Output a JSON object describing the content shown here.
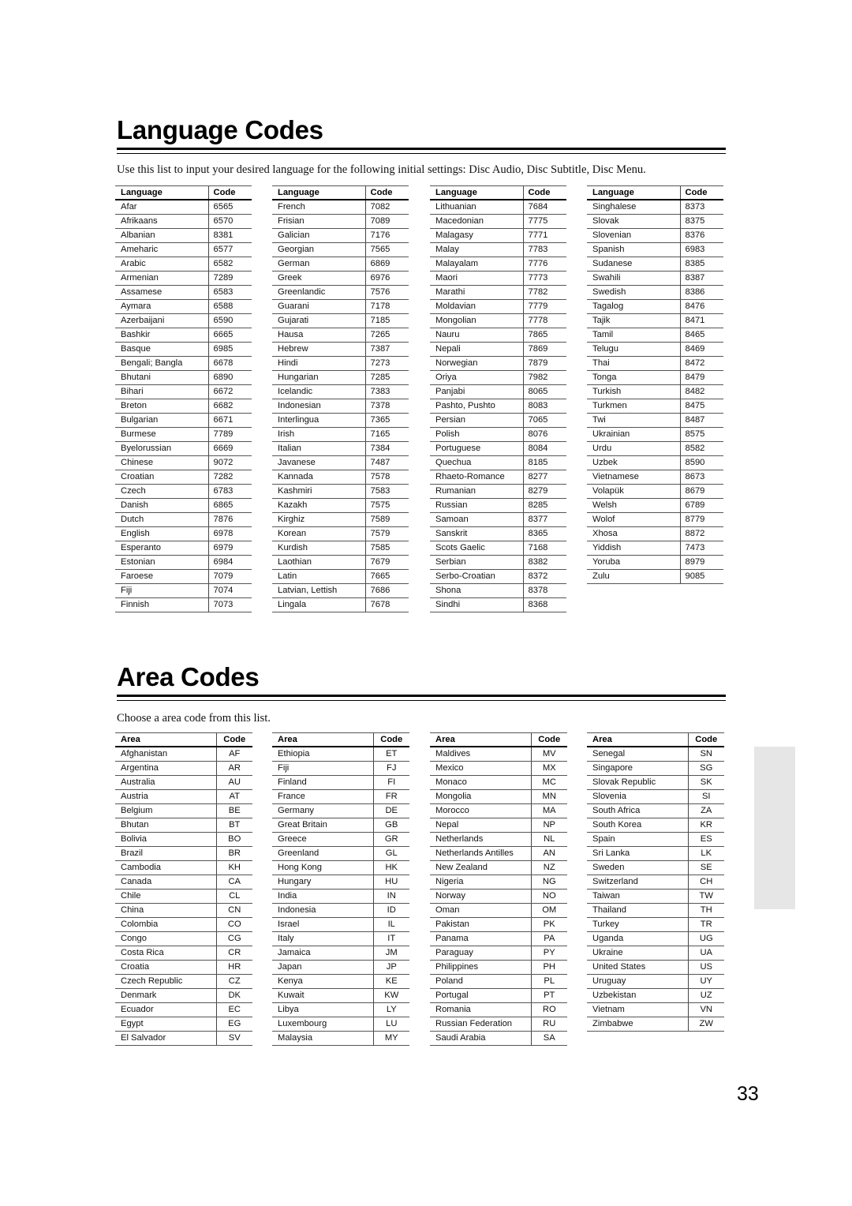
{
  "language_section": {
    "title": "Language Codes",
    "intro": "Use this list to input your desired language for the following initial settings: Disc Audio, Disc Subtitle, Disc Menu.",
    "header": {
      "name": "Language",
      "code": "Code"
    },
    "columns": [
      [
        [
          "Afar",
          "6565"
        ],
        [
          "Afrikaans",
          "6570"
        ],
        [
          "Albanian",
          "8381"
        ],
        [
          "Ameharic",
          "6577"
        ],
        [
          "Arabic",
          "6582"
        ],
        [
          "Armenian",
          "7289"
        ],
        [
          "Assamese",
          "6583"
        ],
        [
          "Aymara",
          "6588"
        ],
        [
          "Azerbaijani",
          "6590"
        ],
        [
          "Bashkir",
          "6665"
        ],
        [
          "Basque",
          "6985"
        ],
        [
          "Bengali; Bangla",
          "6678"
        ],
        [
          "Bhutani",
          "6890"
        ],
        [
          "Bihari",
          "6672"
        ],
        [
          "Breton",
          "6682"
        ],
        [
          "Bulgarian",
          "6671"
        ],
        [
          "Burmese",
          "7789"
        ],
        [
          "Byelorussian",
          "6669"
        ],
        [
          "Chinese",
          "9072"
        ],
        [
          "Croatian",
          "7282"
        ],
        [
          "Czech",
          "6783"
        ],
        [
          "Danish",
          "6865"
        ],
        [
          "Dutch",
          "7876"
        ],
        [
          "English",
          "6978"
        ],
        [
          "Esperanto",
          "6979"
        ],
        [
          "Estonian",
          "6984"
        ],
        [
          "Faroese",
          "7079"
        ],
        [
          "Fiji",
          "7074"
        ],
        [
          "Finnish",
          "7073"
        ]
      ],
      [
        [
          "French",
          "7082"
        ],
        [
          "Frisian",
          "7089"
        ],
        [
          "Galician",
          "7176"
        ],
        [
          "Georgian",
          "7565"
        ],
        [
          "German",
          "6869"
        ],
        [
          "Greek",
          "6976"
        ],
        [
          "Greenlandic",
          "7576"
        ],
        [
          "Guarani",
          "7178"
        ],
        [
          "Gujarati",
          "7185"
        ],
        [
          "Hausa",
          "7265"
        ],
        [
          "Hebrew",
          "7387"
        ],
        [
          "Hindi",
          "7273"
        ],
        [
          "Hungarian",
          "7285"
        ],
        [
          "Icelandic",
          "7383"
        ],
        [
          "Indonesian",
          "7378"
        ],
        [
          "Interlingua",
          "7365"
        ],
        [
          "Irish",
          "7165"
        ],
        [
          "Italian",
          "7384"
        ],
        [
          "Javanese",
          "7487"
        ],
        [
          "Kannada",
          "7578"
        ],
        [
          "Kashmiri",
          "7583"
        ],
        [
          "Kazakh",
          "7575"
        ],
        [
          "Kirghiz",
          "7589"
        ],
        [
          "Korean",
          "7579"
        ],
        [
          "Kurdish",
          "7585"
        ],
        [
          "Laothian",
          "7679"
        ],
        [
          "Latin",
          "7665"
        ],
        [
          "Latvian, Lettish",
          "7686"
        ],
        [
          "Lingala",
          "7678"
        ]
      ],
      [
        [
          "Lithuanian",
          "7684"
        ],
        [
          "Macedonian",
          "7775"
        ],
        [
          "Malagasy",
          "7771"
        ],
        [
          "Malay",
          "7783"
        ],
        [
          "Malayalam",
          "7776"
        ],
        [
          "Maori",
          "7773"
        ],
        [
          "Marathi",
          "7782"
        ],
        [
          "Moldavian",
          "7779"
        ],
        [
          "Mongolian",
          "7778"
        ],
        [
          "Nauru",
          "7865"
        ],
        [
          "Nepali",
          "7869"
        ],
        [
          "Norwegian",
          "7879"
        ],
        [
          "Oriya",
          "7982"
        ],
        [
          "Panjabi",
          "8065"
        ],
        [
          "Pashto, Pushto",
          "8083"
        ],
        [
          "Persian",
          "7065"
        ],
        [
          "Polish",
          "8076"
        ],
        [
          "Portuguese",
          "8084"
        ],
        [
          "Quechua",
          "8185"
        ],
        [
          "Rhaeto-Romance",
          "8277"
        ],
        [
          "Rumanian",
          "8279"
        ],
        [
          "Russian",
          "8285"
        ],
        [
          "Samoan",
          "8377"
        ],
        [
          "Sanskrit",
          "8365"
        ],
        [
          "Scots Gaelic",
          "7168"
        ],
        [
          "Serbian",
          "8382"
        ],
        [
          "Serbo-Croatian",
          "8372"
        ],
        [
          "Shona",
          "8378"
        ],
        [
          "Sindhi",
          "8368"
        ]
      ],
      [
        [
          "Singhalese",
          "8373"
        ],
        [
          "Slovak",
          "8375"
        ],
        [
          "Slovenian",
          "8376"
        ],
        [
          "Spanish",
          "6983"
        ],
        [
          "Sudanese",
          "8385"
        ],
        [
          "Swahili",
          "8387"
        ],
        [
          "Swedish",
          "8386"
        ],
        [
          "Tagalog",
          "8476"
        ],
        [
          "Tajik",
          "8471"
        ],
        [
          "Tamil",
          "8465"
        ],
        [
          "Telugu",
          "8469"
        ],
        [
          "Thai",
          "8472"
        ],
        [
          "Tonga",
          "8479"
        ],
        [
          "Turkish",
          "8482"
        ],
        [
          "Turkmen",
          "8475"
        ],
        [
          "Twi",
          "8487"
        ],
        [
          "Ukrainian",
          "8575"
        ],
        [
          "Urdu",
          "8582"
        ],
        [
          "Uzbek",
          "8590"
        ],
        [
          "Vietnamese",
          "8673"
        ],
        [
          "Volapük",
          "8679"
        ],
        [
          "Welsh",
          "6789"
        ],
        [
          "Wolof",
          "8779"
        ],
        [
          "Xhosa",
          "8872"
        ],
        [
          "Yiddish",
          "7473"
        ],
        [
          "Yoruba",
          "8979"
        ],
        [
          "Zulu",
          "9085"
        ]
      ]
    ]
  },
  "area_section": {
    "title": "Area Codes",
    "intro": "Choose a area code from this list.",
    "header": {
      "name": "Area",
      "code": "Code"
    },
    "columns": [
      [
        [
          "Afghanistan",
          "AF"
        ],
        [
          "Argentina",
          "AR"
        ],
        [
          "Australia",
          "AU"
        ],
        [
          "Austria",
          "AT"
        ],
        [
          "Belgium",
          "BE"
        ],
        [
          "Bhutan",
          "BT"
        ],
        [
          "Bolivia",
          "BO"
        ],
        [
          "Brazil",
          "BR"
        ],
        [
          "Cambodia",
          "KH"
        ],
        [
          "Canada",
          "CA"
        ],
        [
          "Chile",
          "CL"
        ],
        [
          "China",
          "CN"
        ],
        [
          "Colombia",
          "CO"
        ],
        [
          "Congo",
          "CG"
        ],
        [
          "Costa Rica",
          "CR"
        ],
        [
          "Croatia",
          "HR"
        ],
        [
          "Czech Republic",
          "CZ"
        ],
        [
          "Denmark",
          "DK"
        ],
        [
          "Ecuador",
          "EC"
        ],
        [
          "Egypt",
          "EG"
        ],
        [
          "El Salvador",
          "SV"
        ]
      ],
      [
        [
          "Ethiopia",
          "ET"
        ],
        [
          "Fiji",
          "FJ"
        ],
        [
          "Finland",
          "FI"
        ],
        [
          "France",
          "FR"
        ],
        [
          "Germany",
          "DE"
        ],
        [
          "Great Britain",
          "GB"
        ],
        [
          "Greece",
          "GR"
        ],
        [
          "Greenland",
          "GL"
        ],
        [
          "Hong Kong",
          "HK"
        ],
        [
          "Hungary",
          "HU"
        ],
        [
          "India",
          "IN"
        ],
        [
          "Indonesia",
          "ID"
        ],
        [
          "Israel",
          "IL"
        ],
        [
          "Italy",
          "IT"
        ],
        [
          "Jamaica",
          "JM"
        ],
        [
          "Japan",
          "JP"
        ],
        [
          "Kenya",
          "KE"
        ],
        [
          "Kuwait",
          "KW"
        ],
        [
          "Libya",
          "LY"
        ],
        [
          "Luxembourg",
          "LU"
        ],
        [
          "Malaysia",
          "MY"
        ]
      ],
      [
        [
          "Maldives",
          "MV"
        ],
        [
          "Mexico",
          "MX"
        ],
        [
          "Monaco",
          "MC"
        ],
        [
          "Mongolia",
          "MN"
        ],
        [
          "Morocco",
          "MA"
        ],
        [
          "Nepal",
          "NP"
        ],
        [
          "Netherlands",
          "NL"
        ],
        [
          "Netherlands Antilles",
          "AN"
        ],
        [
          "New Zealand",
          "NZ"
        ],
        [
          "Nigeria",
          "NG"
        ],
        [
          "Norway",
          "NO"
        ],
        [
          "Oman",
          "OM"
        ],
        [
          "Pakistan",
          "PK"
        ],
        [
          "Panama",
          "PA"
        ],
        [
          "Paraguay",
          "PY"
        ],
        [
          "Philippines",
          "PH"
        ],
        [
          "Poland",
          "PL"
        ],
        [
          "Portugal",
          "PT"
        ],
        [
          "Romania",
          "RO"
        ],
        [
          "Russian Federation",
          "RU"
        ],
        [
          "Saudi Arabia",
          "SA"
        ]
      ],
      [
        [
          "Senegal",
          "SN"
        ],
        [
          "Singapore",
          "SG"
        ],
        [
          "Slovak Republic",
          "SK"
        ],
        [
          "Slovenia",
          "SI"
        ],
        [
          "South Africa",
          "ZA"
        ],
        [
          "South Korea",
          "KR"
        ],
        [
          "Spain",
          "ES"
        ],
        [
          "Sri Lanka",
          "LK"
        ],
        [
          "Sweden",
          "SE"
        ],
        [
          "Switzerland",
          "CH"
        ],
        [
          "Taiwan",
          "TW"
        ],
        [
          "Thailand",
          "TH"
        ],
        [
          "Turkey",
          "TR"
        ],
        [
          "Uganda",
          "UG"
        ],
        [
          "Ukraine",
          "UA"
        ],
        [
          "United States",
          "US"
        ],
        [
          "Uruguay",
          "UY"
        ],
        [
          "Uzbekistan",
          "UZ"
        ],
        [
          "Vietnam",
          "VN"
        ],
        [
          "Zimbabwe",
          "ZW"
        ]
      ]
    ]
  },
  "page_number": "33"
}
